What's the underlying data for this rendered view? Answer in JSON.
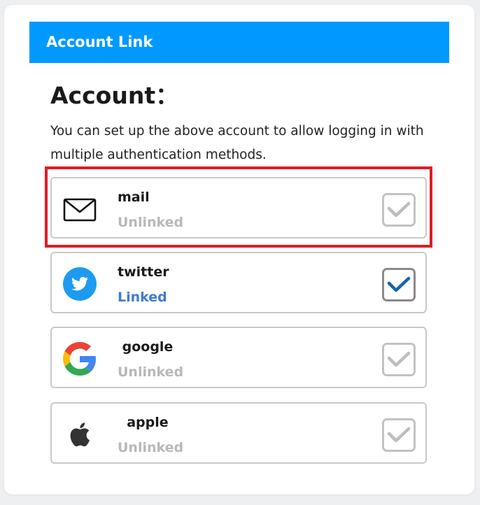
{
  "header": {
    "title": "Account Link"
  },
  "section": {
    "title": "Account：",
    "description": "You can set up the above account to allow logging in with multiple authentication methods."
  },
  "accounts": [
    {
      "name": "mail",
      "status": "Unlinked",
      "linked": false,
      "icon": "mail-icon"
    },
    {
      "name": "twitter",
      "status": "Linked",
      "linked": true,
      "icon": "twitter-icon"
    },
    {
      "name": " google",
      "status": "Unlinked",
      "linked": false,
      "icon": "google-icon"
    },
    {
      "name": "  apple",
      "status": "Unlinked",
      "linked": false,
      "icon": "apple-icon"
    }
  ],
  "colors": {
    "header_bg": "#0099ff",
    "linked_text": "#3e7bd6",
    "unlinked_text": "#b8b8b8",
    "checkmark_on": "#1565a8",
    "checkmark_off": "#bdbdbd",
    "highlight": "#e01b24"
  }
}
